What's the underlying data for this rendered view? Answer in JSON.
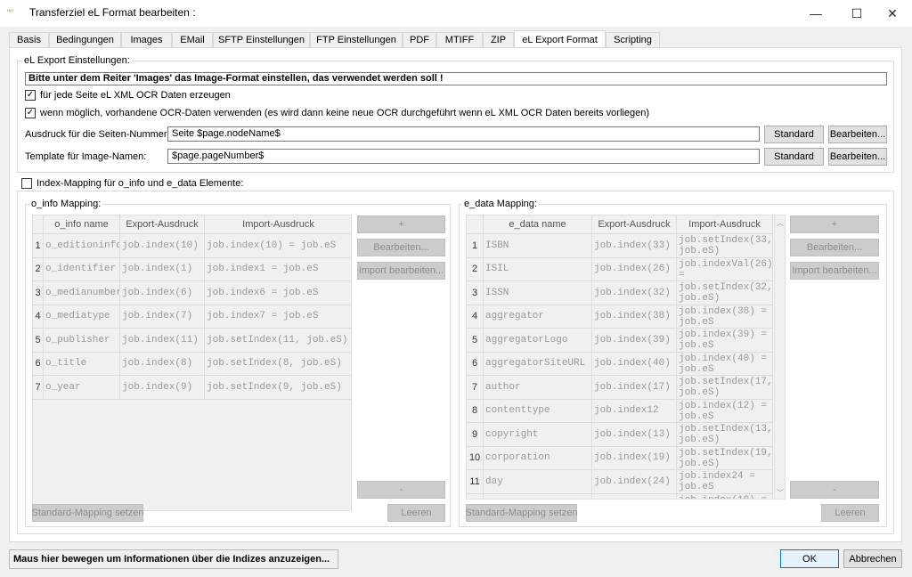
{
  "window": {
    "title": "Transferziel eL Format bearbeiten :",
    "app_icon_text": "ᴴᴹ·ᶠ",
    "minimize": "—",
    "maximize": "☐",
    "close": "✕"
  },
  "tabs": [
    {
      "label": "Basis"
    },
    {
      "label": "Bedingungen"
    },
    {
      "label": "Images"
    },
    {
      "label": "EMail"
    },
    {
      "label": "SFTP Einstellungen"
    },
    {
      "label": "FTP Einstellungen"
    },
    {
      "label": "PDF"
    },
    {
      "label": "MTIFF"
    },
    {
      "label": "ZIP"
    },
    {
      "label": "eL Export Format",
      "active": true
    },
    {
      "label": "Scripting"
    }
  ],
  "settings": {
    "group_title": "eL Export Einstellungen:",
    "notice": "Bitte unter dem Reiter 'Images' das Image-Format einstellen, das verwendet werden soll !",
    "cb1": {
      "label": "für jede Seite eL XML OCR Daten erzeugen",
      "checked": "✓"
    },
    "cb2": {
      "label": "wenn möglich, vorhandene OCR-Daten verwenden (es wird dann keine neue OCR durchgeführt wenn eL XML OCR Daten bereits vorliegen)",
      "checked": "✓"
    },
    "page_number": {
      "label": "Ausdruck für die Seiten-Nummer:",
      "value": "Seite $page.nodeName$",
      "standard": "Standard",
      "edit": "Bearbeiten..."
    },
    "image_template": {
      "label": "Template für Image-Namen:",
      "value": "$page.pageNumber$",
      "standard": "Standard",
      "edit": "Bearbeiten..."
    }
  },
  "index_mapping": {
    "checkbox_label": "Index-Mapping für o_info und e_data Elemente:",
    "checked": ""
  },
  "o_info": {
    "title": "o_info Mapping:",
    "headers": [
      "",
      "o_info name",
      "Export-Ausdruck",
      "Import-Ausdruck"
    ],
    "rows": [
      [
        "1",
        "o_editioninfo",
        "job.index(10)",
        "job.index(10) = job.eS"
      ],
      [
        "2",
        "o_identifier",
        "job.index(1)",
        "job.index1 = job.eS"
      ],
      [
        "3",
        "o_medianumber",
        "job.index(6)",
        "job.index6 = job.eS"
      ],
      [
        "4",
        "o_mediatype",
        "job.index(7)",
        "job.index7 = job.eS"
      ],
      [
        "5",
        "o_publisher",
        "job.index(11)",
        "job.setIndex(11, job.eS)"
      ],
      [
        "6",
        "o_title",
        "job.index(8)",
        "job.setIndex(8, job.eS)"
      ],
      [
        "7",
        "o_year",
        "job.index(9)",
        "job.setIndex(9, job.eS)"
      ]
    ],
    "add": "+",
    "edit": "Bearbeiten...",
    "import_edit": "Import bearbeiten...",
    "remove": "-",
    "standard_mapping": "Standard-Mapping setzen",
    "clear": "Leeren"
  },
  "e_data": {
    "title": "e_data Mapping:",
    "headers": [
      "",
      "e_data name",
      "Export-Ausdruck",
      "Import-Ausdruck"
    ],
    "rows": [
      [
        "1",
        "ISBN",
        "job.index(33)",
        "job.setIndex(33, job.eS)"
      ],
      [
        "2",
        "ISIL",
        "job.index(26)",
        "job.indexVal(26) = job.externalStr"
      ],
      [
        "3",
        "ISSN",
        "job.index(32)",
        "job.setIndex(32, job.eS)"
      ],
      [
        "4",
        "aggregator",
        "job.index(38)",
        "job.index(38) = job.eS"
      ],
      [
        "5",
        "aggregatorLogo",
        "job.index(39)",
        "job.index(39) = job.eS"
      ],
      [
        "6",
        "aggregatorSiteURL",
        "job.index(40)",
        "job.index(40) = job.eS"
      ],
      [
        "7",
        "author",
        "job.index(17)",
        "job.setIndex(17, job.eS)"
      ],
      [
        "8",
        "contenttype",
        "job.index12",
        "job.index(12) = job.eS"
      ],
      [
        "9",
        "copyright",
        "job.index(13)",
        "job.setIndex(13, job.eS)"
      ],
      [
        "10",
        "corporation",
        "job.index(19)",
        "job.setIndex(19, job.eS)"
      ],
      [
        "11",
        "day",
        "job.index(24)",
        "job.index24 = job.eS"
      ],
      [
        "",
        "",
        "",
        "job.index(10) ="
      ]
    ],
    "add": "+",
    "edit": "Bearbeiten...",
    "import_edit": "Import bearbeiten...",
    "remove": "-",
    "standard_mapping": "Standard-Mapping setzen",
    "clear": "Leeren"
  },
  "status": {
    "text": "Maus hier bewegen um Informationen über die Indizes anzuzeigen..."
  },
  "footer": {
    "ok": "OK",
    "cancel": "Abbrechen"
  }
}
